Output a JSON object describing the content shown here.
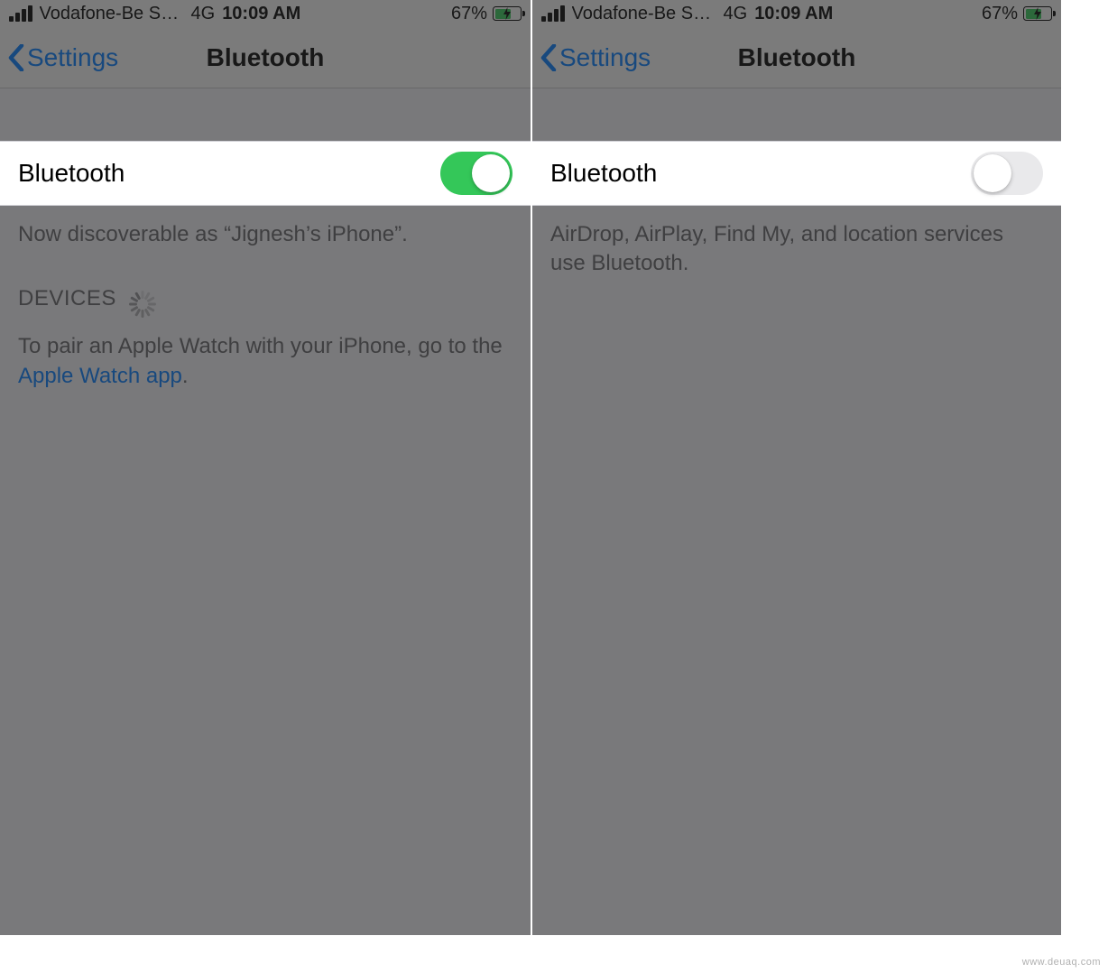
{
  "left": {
    "status": {
      "carrier": "Vodafone-Be Sa...",
      "network": "4G",
      "time": "10:09 AM",
      "battery_pct": "67%",
      "battery_fill": 67
    },
    "nav": {
      "back": "Settings",
      "title": "Bluetooth"
    },
    "toggle": {
      "label": "Bluetooth",
      "on": true
    },
    "discoverable": "Now discoverable as “Jignesh’s iPhone”.",
    "devices_header": "DEVICES",
    "pair_text_prefix": "To pair an Apple Watch with your iPhone, go to the ",
    "pair_text_link": "Apple Watch app",
    "pair_text_suffix": "."
  },
  "right": {
    "status": {
      "carrier": "Vodafone-Be Sa...",
      "network": "4G",
      "time": "10:09 AM",
      "battery_pct": "67%",
      "battery_fill": 67
    },
    "nav": {
      "back": "Settings",
      "title": "Bluetooth"
    },
    "toggle": {
      "label": "Bluetooth",
      "on": false
    },
    "info": "AirDrop, AirPlay, Find My, and location services use Bluetooth."
  },
  "watermark": "www.deuaq.com",
  "colors": {
    "accent": "#007aff",
    "toggle_on": "#34c759"
  }
}
